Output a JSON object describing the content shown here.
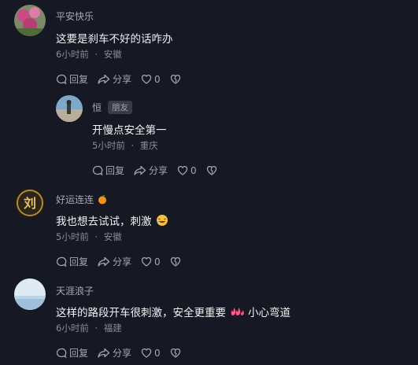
{
  "comments": [
    {
      "username": "平安快乐",
      "content": "这要是刹车不好的话咋办",
      "time": "6小时前",
      "location": "安徽",
      "reply_label": "回复",
      "share_label": "分享",
      "likes": "0"
    },
    {
      "username": "恒",
      "badge": "朋友",
      "content": "开慢点安全第一",
      "time": "5小时前",
      "location": "重庆",
      "reply_label": "回复",
      "share_label": "分享",
      "likes": "0"
    },
    {
      "username": "好运连连",
      "content": "我也想去试试，刺激",
      "time": "5小时前",
      "location": "安徽",
      "reply_label": "回复",
      "share_label": "分享",
      "likes": "0"
    },
    {
      "username": "天涯浪子",
      "content_before": "这样的路段开车很刺激，安全更重要",
      "content_after": "小心弯道",
      "time": "6小时前",
      "location": "福建",
      "reply_label": "回复",
      "share_label": "分享",
      "likes": "0"
    }
  ],
  "meta_separator": "·",
  "colors": {
    "background": "#161823",
    "text": "#f1f1f3",
    "muted": "#8a8b94"
  }
}
